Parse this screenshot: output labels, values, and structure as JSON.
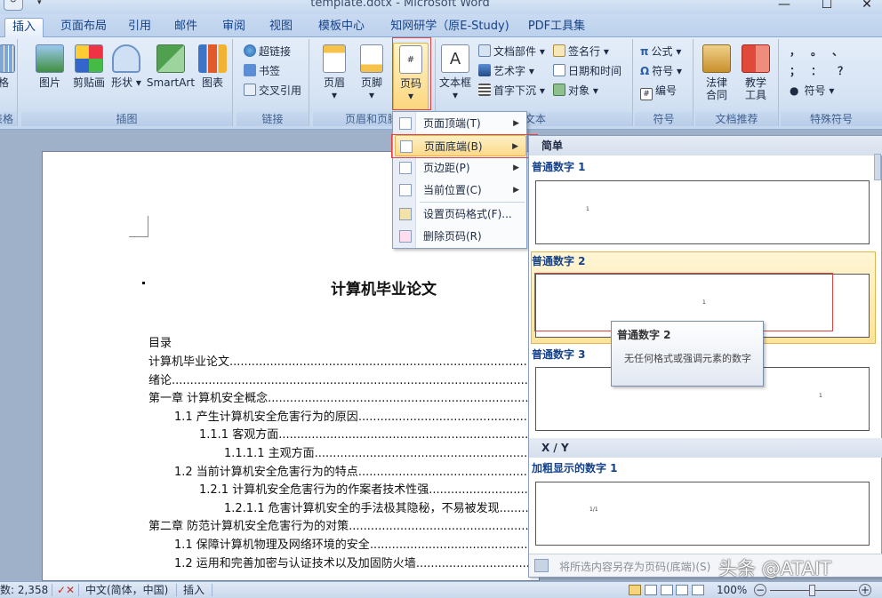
{
  "window": {
    "title": "template.dotx - Microsoft Word",
    "controls": [
      "—",
      "☐",
      "✕"
    ]
  },
  "tabs": [
    "插入",
    "页面布局",
    "引用",
    "邮件",
    "审阅",
    "视图",
    "模板中心",
    "知网研学（原E-Study)",
    "PDF工具集"
  ],
  "ribbon": {
    "groups": {
      "table": "表格",
      "illustrations": "插图",
      "links": "链接",
      "header_footer": "页眉和页脚",
      "text": "文本",
      "symbols": "符号",
      "doc_recommend": "文档推荐",
      "special_symbols": "特殊符号"
    },
    "table_btn": "表格",
    "picture": "图片",
    "clipart": "剪贴画",
    "shapes": "形状",
    "smartart": "SmartArt",
    "chart": "图表",
    "hyperlink": "超链接",
    "bookmark": "书签",
    "crossref": "交叉引用",
    "header": "页眉",
    "footer": "页脚",
    "pagenum": "页码",
    "textbox": "文本框",
    "docparts": "文档部件",
    "wordart": "艺术字",
    "dropcap": "首字下沉",
    "sigline": "签名行",
    "datetime": "日期和时间",
    "object": "对象",
    "equation": "公式",
    "symbol": "符号",
    "numbering": "编号",
    "law_contract": "法律\n合同",
    "teaching_tools": "教学\n工具",
    "special_chars": "符号"
  },
  "menu": {
    "items": [
      {
        "label": "页面顶端(T)",
        "arrow": true
      },
      {
        "label": "页面底端(B)",
        "arrow": true
      },
      {
        "label": "页边距(P)",
        "arrow": true
      },
      {
        "label": "当前位置(C)",
        "arrow": true
      },
      {
        "label": "设置页码格式(F)...",
        "arrow": false
      },
      {
        "label": "删除页码(R)",
        "arrow": false
      }
    ]
  },
  "gallery": {
    "header_simple": "简单",
    "plain1": "普通数字 1",
    "plain2": "普通数字 2",
    "plain3": "普通数字 3",
    "header_xy": "X / Y",
    "bold1": "加粗显示的数字 1",
    "pn": "1",
    "pn_xy": "1/1",
    "footer_text": "将所选内容另存为页码(底端)(S)"
  },
  "tooltip": {
    "title": "普通数字 2",
    "desc": "无任何格式或强调元素的数字"
  },
  "document": {
    "title": "计算机毕业论文",
    "toc_title": "目录",
    "toc": [
      {
        "text": "计算机毕业论文",
        "level": 0
      },
      {
        "text": "绪论",
        "level": 0
      },
      {
        "text": "第一章  计算机安全概念",
        "level": 0
      },
      {
        "text": "1.1  产生计算机安全危害行为的原因",
        "level": 1
      },
      {
        "text": "1.1.1  客观方面",
        "level": 2
      },
      {
        "text": "1.1.1.1  主观方面",
        "level": 3
      },
      {
        "text": "1.2  当前计算机安全危害行为的特点",
        "level": 1
      },
      {
        "text": "1.2.1  计算机安全危害行为的作案者技术性强",
        "level": 2
      },
      {
        "text": "1.2.1.1  危害计算机安全的手法极其隐秘，不易被发现",
        "level": 3
      },
      {
        "text": "第二章  防范计算机安全危害行为的对策",
        "level": 0
      },
      {
        "text": "1.1  保障计算机物理及网络环境的安全",
        "level": 1
      },
      {
        "text": "1.2  运用和完善加密与认证技术以及加固防火墙",
        "level": 1
      }
    ]
  },
  "status": {
    "wordcount": "数: 2,358",
    "language": "中文(简体，中国)",
    "mode": "插入",
    "zoom": "100%"
  },
  "watermark": "头条 @ATAIT"
}
